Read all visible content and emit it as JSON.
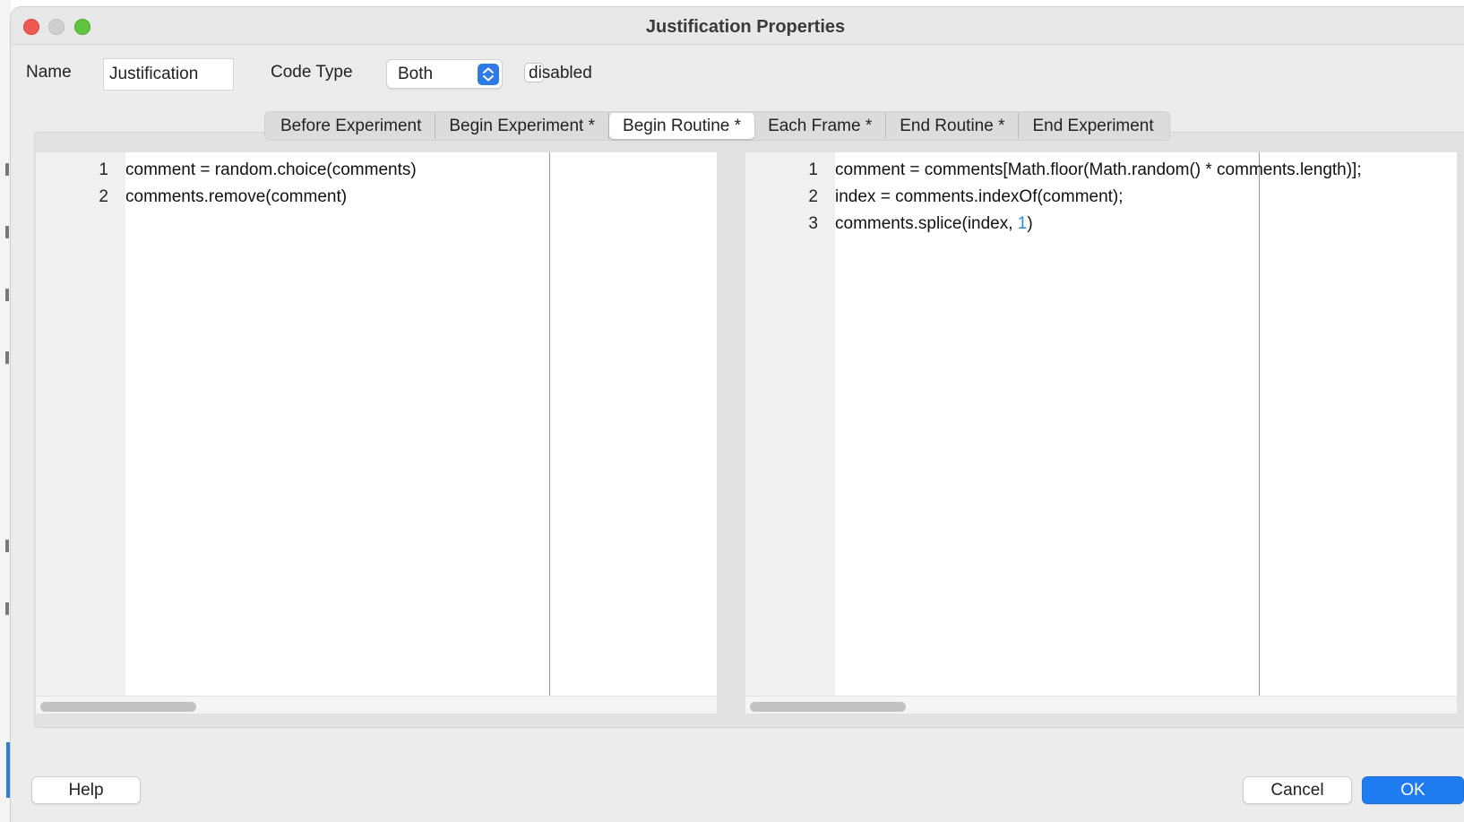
{
  "window": {
    "title": "Justification Properties"
  },
  "form": {
    "name_label": "Name",
    "name_value": "Justification",
    "code_type_label": "Code Type",
    "code_type_value": "Both",
    "disabled_label": "disabled",
    "disabled_checked": false
  },
  "tabs": [
    {
      "label": "Before Experiment",
      "active": false
    },
    {
      "label": "Begin Experiment *",
      "active": false
    },
    {
      "label": "Begin Routine *",
      "active": true
    },
    {
      "label": "Each Frame *",
      "active": false
    },
    {
      "label": "End Routine *",
      "active": false
    },
    {
      "label": "End Experiment",
      "active": false
    }
  ],
  "editors": {
    "python": {
      "lines": [
        {
          "number": "1",
          "code": "comment = random.choice(comments)"
        },
        {
          "number": "2",
          "code": "comments.remove(comment)"
        }
      ]
    },
    "javascript": {
      "lines": [
        {
          "number": "1",
          "code": "comment = comments[Math.floor(Math.random() * comments.length)];"
        },
        {
          "number": "2",
          "code": "index = comments.indexOf(comment);"
        },
        {
          "number": "3",
          "code_before": "comments.splice(index, ",
          "code_number": "1",
          "code_after": ")"
        }
      ]
    }
  },
  "buttons": {
    "help": "Help",
    "cancel": "Cancel",
    "ok": "OK"
  },
  "colors": {
    "accent": "#1f7cf0",
    "number_literal": "#2e8bd0",
    "close": "#ee5a52",
    "maximize": "#5fc43f"
  }
}
